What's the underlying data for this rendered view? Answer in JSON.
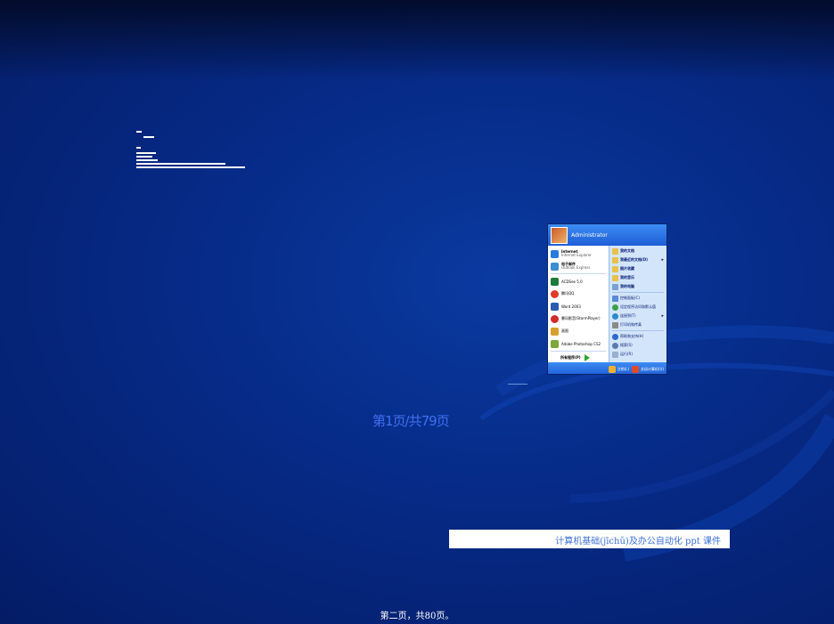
{
  "start_menu": {
    "user": "Administrator",
    "pinned": [
      {
        "label": "Internet",
        "sub": "Internet Explorer",
        "icon": "ie-icon",
        "color": "#2a7be0"
      },
      {
        "label": "电子邮件",
        "sub": "Outlook Express",
        "icon": "mail-icon",
        "color": "#3a8fd0"
      }
    ],
    "recent": [
      {
        "label": "ACDSee 5.0",
        "icon": "acdsee-icon",
        "color": "#1d7a3a"
      },
      {
        "label": "腾讯QQ",
        "icon": "qq-icon",
        "color": "#e03a2a"
      },
      {
        "label": "Word 2003",
        "icon": "word-icon",
        "color": "#2a5bb0"
      },
      {
        "label": "暴风影音(StormPlayer)",
        "icon": "player-icon",
        "color": "#d42a2a"
      },
      {
        "label": "画图",
        "icon": "paint-icon",
        "color": "#d6a02a"
      },
      {
        "label": "Adobe Photoshop CS2",
        "icon": "photoshop-icon",
        "color": "#7aa83a"
      }
    ],
    "all_programs": "所有程序(P)",
    "right_items": [
      {
        "label": "我的文档",
        "icon": "folder-icon",
        "color": "#e8c24a",
        "chevron": ""
      },
      {
        "label": "我最近的文档(D)",
        "icon": "recent-docs-icon",
        "color": "#e8c24a",
        "chevron": "▸"
      },
      {
        "label": "图片收藏",
        "icon": "pictures-icon",
        "color": "#e8c24a",
        "chevron": ""
      },
      {
        "label": "我的音乐",
        "icon": "music-icon",
        "color": "#e8c24a",
        "chevron": ""
      },
      {
        "label": "我的电脑",
        "icon": "computer-icon",
        "color": "#7aa0d8",
        "chevron": ""
      }
    ],
    "right_items2": [
      {
        "label": "控制面板(C)",
        "icon": "control-panel-icon",
        "color": "#5a8ad8",
        "chevron": ""
      },
      {
        "label": "设定程序访问和默认值",
        "icon": "defaults-icon",
        "color": "#3aa04a",
        "chevron": ""
      },
      {
        "label": "连接到(T)",
        "icon": "connect-icon",
        "color": "#2a8ad0",
        "chevron": "▸"
      },
      {
        "label": "打印机和传真",
        "icon": "printer-icon",
        "color": "#8a8a8a",
        "chevron": ""
      }
    ],
    "right_items3": [
      {
        "label": "帮助和支持(H)",
        "icon": "help-icon",
        "color": "#2a6ad0",
        "chevron": ""
      },
      {
        "label": "搜索(S)",
        "icon": "search-icon",
        "color": "#5a7ab0",
        "chevron": ""
      },
      {
        "label": "运行(R)",
        "icon": "run-icon",
        "color": "#9ab0d0",
        "chevron": ""
      }
    ],
    "logoff": "注销(L)",
    "shutdown": "关闭计算机(U)"
  },
  "page_label": "第1页/共79页",
  "footer_title": "计算机基础(jīchǔ)及办公自动化 ppt 课件",
  "bottom_page": "第二页，共80页。"
}
